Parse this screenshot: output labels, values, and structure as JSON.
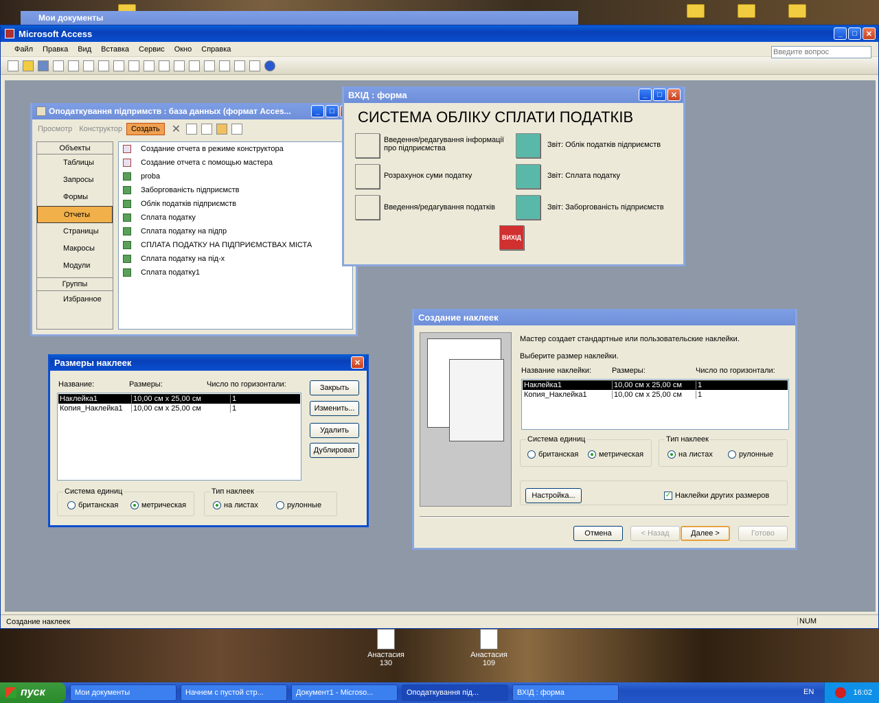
{
  "behind_window": {
    "title": "Мои документы"
  },
  "access": {
    "title": "Microsoft Access",
    "menu": [
      "Файл",
      "Правка",
      "Вид",
      "Вставка",
      "Сервис",
      "Окно",
      "Справка"
    ],
    "help_placeholder": "Введите вопрос",
    "status": "Создание наклеек",
    "status_num": "NUM"
  },
  "db": {
    "title": "Оподаткування підпримств : база данных (формат Acces...",
    "tb_view": "Просмотр",
    "tb_design": "Конструктор",
    "tb_new": "Создать",
    "objects_header": "Объекты",
    "objects": [
      "Таблицы",
      "Запросы",
      "Формы",
      "Отчеты",
      "Страницы",
      "Макросы",
      "Модули"
    ],
    "groups_header": "Группы",
    "favorites": "Избранное",
    "items": [
      "Создание отчета в режиме конструктора",
      "Создание отчета с помощью мастера",
      "proba",
      "Заборгованість підприємств",
      "Облік податків підприємств",
      "Сплата податку",
      "Сплата податку на підпр",
      "СПЛАТА ПОДАТКУ НА ПІДПРИЄМСТВАХ МІСТА",
      "Сплата податку на під-х",
      "Сплата податку1"
    ]
  },
  "form": {
    "title": "ВХІД : форма",
    "heading": "СИСТЕМА ОБЛІКУ СПЛАТИ ПОДАТКІВ",
    "left": [
      "Введення/редагування інформації про підприємства",
      "Розрахунок суми податку",
      "Введення/редагування податків"
    ],
    "right": [
      "Звіт: Облік податків підприємств",
      "Звіт: Сплата податку",
      "Звіт: Заборгованість підприємств"
    ],
    "exit": "ВИХІД"
  },
  "sizes": {
    "title": "Размеры наклеек",
    "col_name": "Название:",
    "col_size": "Размеры:",
    "col_count": "Число по горизонтали:",
    "rows": [
      [
        "Наклейка1",
        "10,00 см x 25,00 см",
        "1"
      ],
      [
        "Копия_Наклейка1",
        "10,00 см x 25,00 см",
        "1"
      ]
    ],
    "btn_close": "Закрыть",
    "btn_edit": "Изменить...",
    "btn_delete": "Удалить",
    "btn_dup": "Дублироват",
    "units_label": "Система единиц",
    "british": "британская",
    "metric": "метрическая",
    "type_label": "Тип наклеек",
    "sheets": "на листах",
    "roll": "рулонные"
  },
  "wizard": {
    "title": "Создание наклеек",
    "intro": "Мастер создает стандартные или пользовательские наклейки.",
    "choose": "Выберите размер наклейки.",
    "col_name": "Название наклейки:",
    "col_size": "Размеры:",
    "col_count": "Число по горизонтали:",
    "rows": [
      [
        "Наклейка1",
        "10,00 см x 25,00 см",
        "1"
      ],
      [
        "Копия_Наклейка1",
        "10,00 см x 25,00 см",
        "1"
      ]
    ],
    "units_label": "Система единиц",
    "british": "британская",
    "metric": "метрическая",
    "type_label": "Тип наклеек",
    "sheets": "на листах",
    "roll": "рулонные",
    "settings": "Настройка...",
    "other_sizes": "Наклейки других размеров",
    "cancel": "Отмена",
    "back": "< Назад",
    "next": "Далее >",
    "finish": "Готово"
  },
  "desktop_icons": [
    {
      "name": "Анастасия",
      "num": "130"
    },
    {
      "name": "Анастасия",
      "num": "109"
    }
  ],
  "taskbar": {
    "start": "пуск",
    "tasks": [
      "Мои документы",
      "Начнем с пустой стр...",
      "Документ1 - Microso...",
      "Оподаткування під...",
      "ВХІД : форма"
    ],
    "lang": "EN",
    "time": "16:02"
  }
}
